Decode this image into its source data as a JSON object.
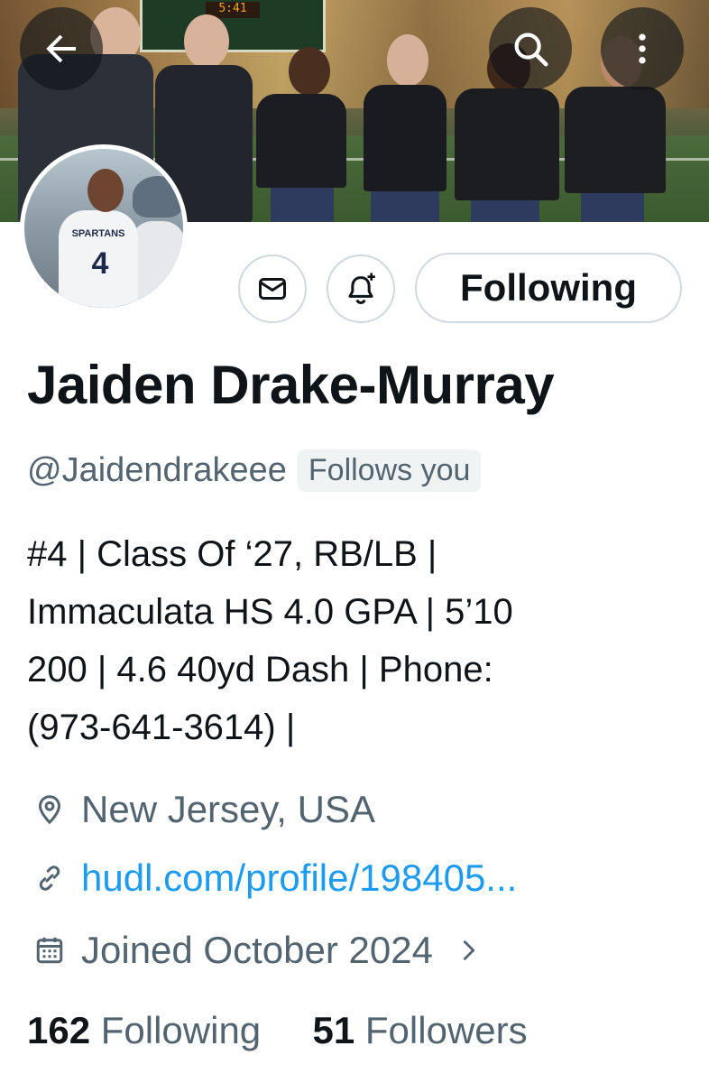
{
  "header": {
    "back_icon": "arrow-left-icon",
    "search_icon": "search-icon",
    "more_icon": "more-vertical-icon",
    "scoreboard_text": "5:41"
  },
  "avatar": {
    "team_text": "SPARTANS",
    "number_text": "4"
  },
  "actions": {
    "message_icon": "mail-icon",
    "notify_icon": "bell-plus-icon",
    "following_label": "Following"
  },
  "profile": {
    "name": "Jaiden Drake-Murray",
    "handle": "@Jaidendrakeee",
    "follows_you": "Follows you",
    "bio_lines": [
      "#4 | Class Of ‘27, RB/LB |",
      "Immaculata HS 4.0 GPA | 5’10",
      "200 | 4.6 40yd Dash | Phone:",
      "(973-641-3614) |"
    ],
    "location": "New Jersey, USA",
    "link": "hudl.com/profile/198405...",
    "joined": "Joined October 2024"
  },
  "stats": {
    "following_count": "162",
    "following_label": "Following",
    "followers_count": "51",
    "followers_label": "Followers"
  },
  "colors": {
    "accent": "#1d9bf0",
    "secondary_text": "#536471",
    "primary_text": "#0f1419",
    "border": "#cfd9de"
  }
}
